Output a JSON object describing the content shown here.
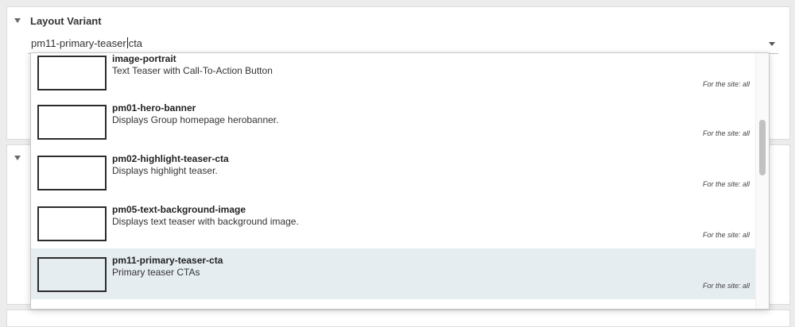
{
  "panels": {
    "layout_variant": {
      "title": "Layout Variant",
      "value_before_caret": "pm11-primary-teaser",
      "value_after_caret": "cta"
    }
  },
  "dropdown": {
    "items": [
      {
        "name": "image-portrait",
        "description": "Text Teaser with Call-To-Action Button",
        "site": "For the site: all",
        "selected": false
      },
      {
        "name": "pm01-hero-banner",
        "description": "Displays Group homepage herobanner.",
        "site": "For the site: all",
        "selected": false
      },
      {
        "name": "pm02-highlight-teaser-cta",
        "description": "Displays highlight teaser.",
        "site": "For the site: all",
        "selected": false
      },
      {
        "name": "pm05-text-background-image",
        "description": "Displays text teaser with background image.",
        "site": "For the site: all",
        "selected": false
      },
      {
        "name": "pm11-primary-teaser-cta",
        "description": "Primary teaser CTAs",
        "site": "For the site: all",
        "selected": true
      }
    ]
  },
  "colors": {
    "selected_row": "#e6edf1",
    "background": "#ececec"
  },
  "icons": [
    "collapse-triangle-icon",
    "dropdown-arrow-icon"
  ]
}
